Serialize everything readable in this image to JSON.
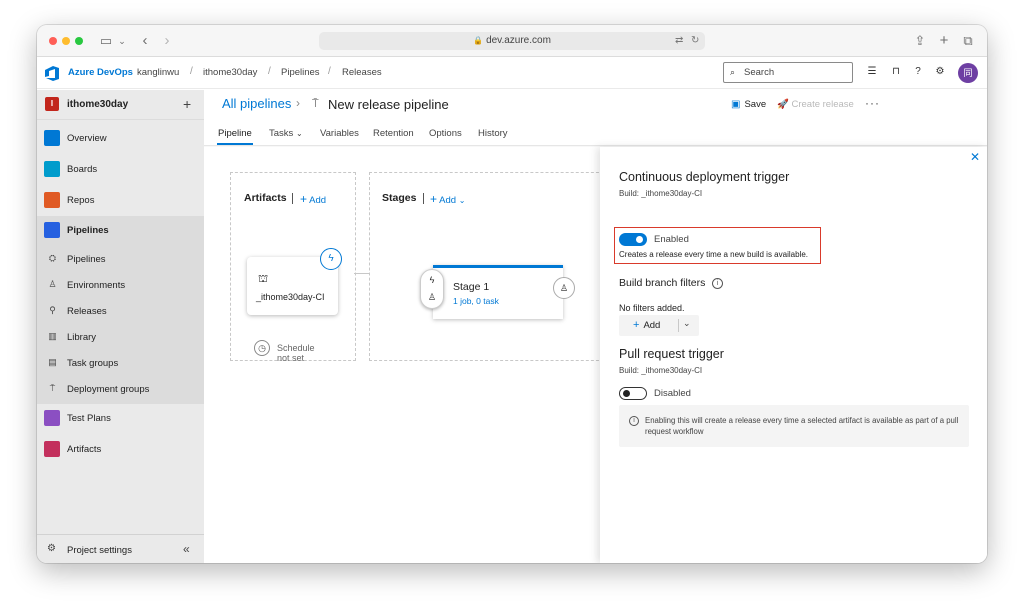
{
  "browser": {
    "url": "dev.azure.com"
  },
  "topbar": {
    "brand": "Azure DevOps",
    "breadcrumbs": [
      "kanglinwu",
      "ithome30day",
      "Pipelines",
      "Releases"
    ],
    "search_placeholder": "Search",
    "avatar_initial": "同"
  },
  "sidebar": {
    "project_initial": "I",
    "project_name": "ithome30day",
    "items": [
      {
        "label": "Overview",
        "color": "#0078d4"
      },
      {
        "label": "Boards",
        "color": "#009ccc"
      },
      {
        "label": "Repos",
        "color": "#e05a24"
      },
      {
        "label": "Pipelines",
        "color": "#2560e0"
      },
      {
        "label": "Test Plans",
        "color": "#8b4fc2"
      },
      {
        "label": "Artifacts",
        "color": "#c3305d"
      }
    ],
    "pipeline_subitems": [
      "Pipelines",
      "Environments",
      "Releases",
      "Library",
      "Task groups",
      "Deployment groups"
    ],
    "settings_label": "Project settings"
  },
  "header": {
    "all_pipelines": "All pipelines",
    "title": "New release pipeline",
    "save_label": "Save",
    "create_release_label": "Create release",
    "tabs": [
      "Pipeline",
      "Tasks",
      "Variables",
      "Retention",
      "Options",
      "History"
    ]
  },
  "canvas": {
    "artifacts_title": "Artifacts",
    "artifacts_add": "Add",
    "artifact_name": "_ithome30day-CI",
    "schedule_text_1": "Schedule",
    "schedule_text_2": "not set",
    "stages_title": "Stages",
    "stages_add": "Add",
    "stage_name": "Stage 1",
    "stage_summary": "1 job, 0 task"
  },
  "panel": {
    "cd_title": "Continuous deployment trigger",
    "cd_build": "Build: _ithome30day-CI",
    "cd_state": "Enabled",
    "cd_help": "Creates a release every time a new build is available.",
    "filters_title": "Build branch filters",
    "no_filters": "No filters added.",
    "add_label": "Add",
    "pr_title": "Pull request trigger",
    "pr_build": "Build: _ithome30day-CI",
    "pr_state": "Disabled",
    "pr_info": "Enabling this will create a release every time a selected artifact is available as part of a pull request workflow"
  }
}
